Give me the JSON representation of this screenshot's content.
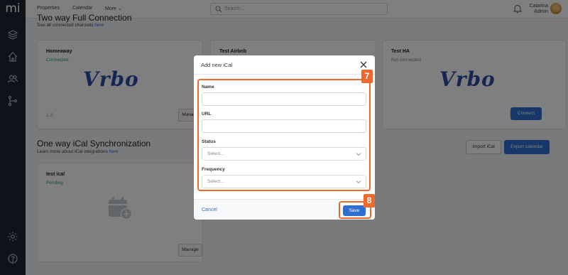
{
  "app": {
    "logo_text": "mi"
  },
  "topbar": {
    "nav": [
      "Properties",
      "Calendar",
      "More"
    ],
    "search_placeholder": "Search...",
    "user_name": "Catarina",
    "user_role": "Admin"
  },
  "sections": {
    "two_way": {
      "title": "Two way Full Connection",
      "subtitle": "See all connected channels",
      "subtitle_link": "here"
    },
    "one_way": {
      "title": "One way iCal Synchronization",
      "subtitle": "Learn more about iCal integrations",
      "subtitle_link": "here",
      "import_label": "Import iCal",
      "export_label": "Export calendar"
    }
  },
  "cards": {
    "homeaway": {
      "title": "Homeaway",
      "status": "Connected",
      "footer": "1-2",
      "button": "Manage",
      "logo": "Vrbo"
    },
    "airbnb": {
      "title": "Test Airbnb"
    },
    "ha": {
      "title": "Test HA",
      "status": "Not connected",
      "button": "Connect",
      "logo": "Vrbo"
    },
    "ical": {
      "title": "test ical",
      "status": "Pending",
      "button": "Manage"
    }
  },
  "modal": {
    "title": "Add new iCal",
    "name_label": "Name",
    "url_label": "URL",
    "status_label": "Status",
    "status_placeholder": "Select...",
    "frequency_label": "Frequency",
    "frequency_placeholder": "Select...",
    "cancel_label": "Cancel",
    "save_label": "Save"
  },
  "annotations": {
    "step_form": "7",
    "step_save": "8"
  },
  "colors": {
    "accent": "#2f6fd1",
    "annotation": "#ee6a2c",
    "sidebar": "#1c2433",
    "success": "#2ea36b"
  }
}
